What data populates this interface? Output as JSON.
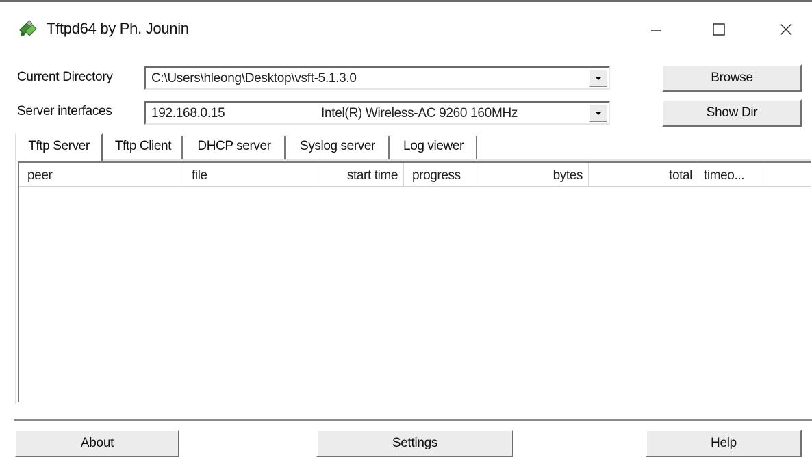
{
  "window": {
    "title": "Tftpd64 by Ph. Jounin",
    "icon": "tftpd-app-icon",
    "controls": {
      "minimize_icon": "minimize-icon",
      "maximize_icon": "maximize-icon",
      "close_icon": "close-icon"
    }
  },
  "fields": {
    "current_directory_label": "Current Directory",
    "current_directory_value": "C:\\Users\\hleong\\Desktop\\vsft-5.1.3.0",
    "server_interfaces_label": "Server interfaces",
    "server_interface_ip": "192.168.0.15",
    "server_interface_adapter": "Intel(R) Wireless-AC 9260 160MHz"
  },
  "buttons": {
    "browse": "Browse",
    "show_dir": "Show Dir",
    "about": "About",
    "settings": "Settings",
    "help": "Help"
  },
  "tabs": [
    {
      "label": "Tftp Server",
      "active": true
    },
    {
      "label": "Tftp Client",
      "active": false
    },
    {
      "label": "DHCP server",
      "active": false
    },
    {
      "label": "Syslog server",
      "active": false
    },
    {
      "label": "Log viewer",
      "active": false
    }
  ],
  "transfer_table": {
    "columns": [
      "peer",
      "file",
      "start time",
      "progress",
      "bytes",
      "total",
      "timeo..."
    ],
    "rows": []
  },
  "colors": {
    "window_bg": "#ffffff",
    "button_face": "#ececec",
    "accent_icon_green": "#3f8f3a"
  }
}
